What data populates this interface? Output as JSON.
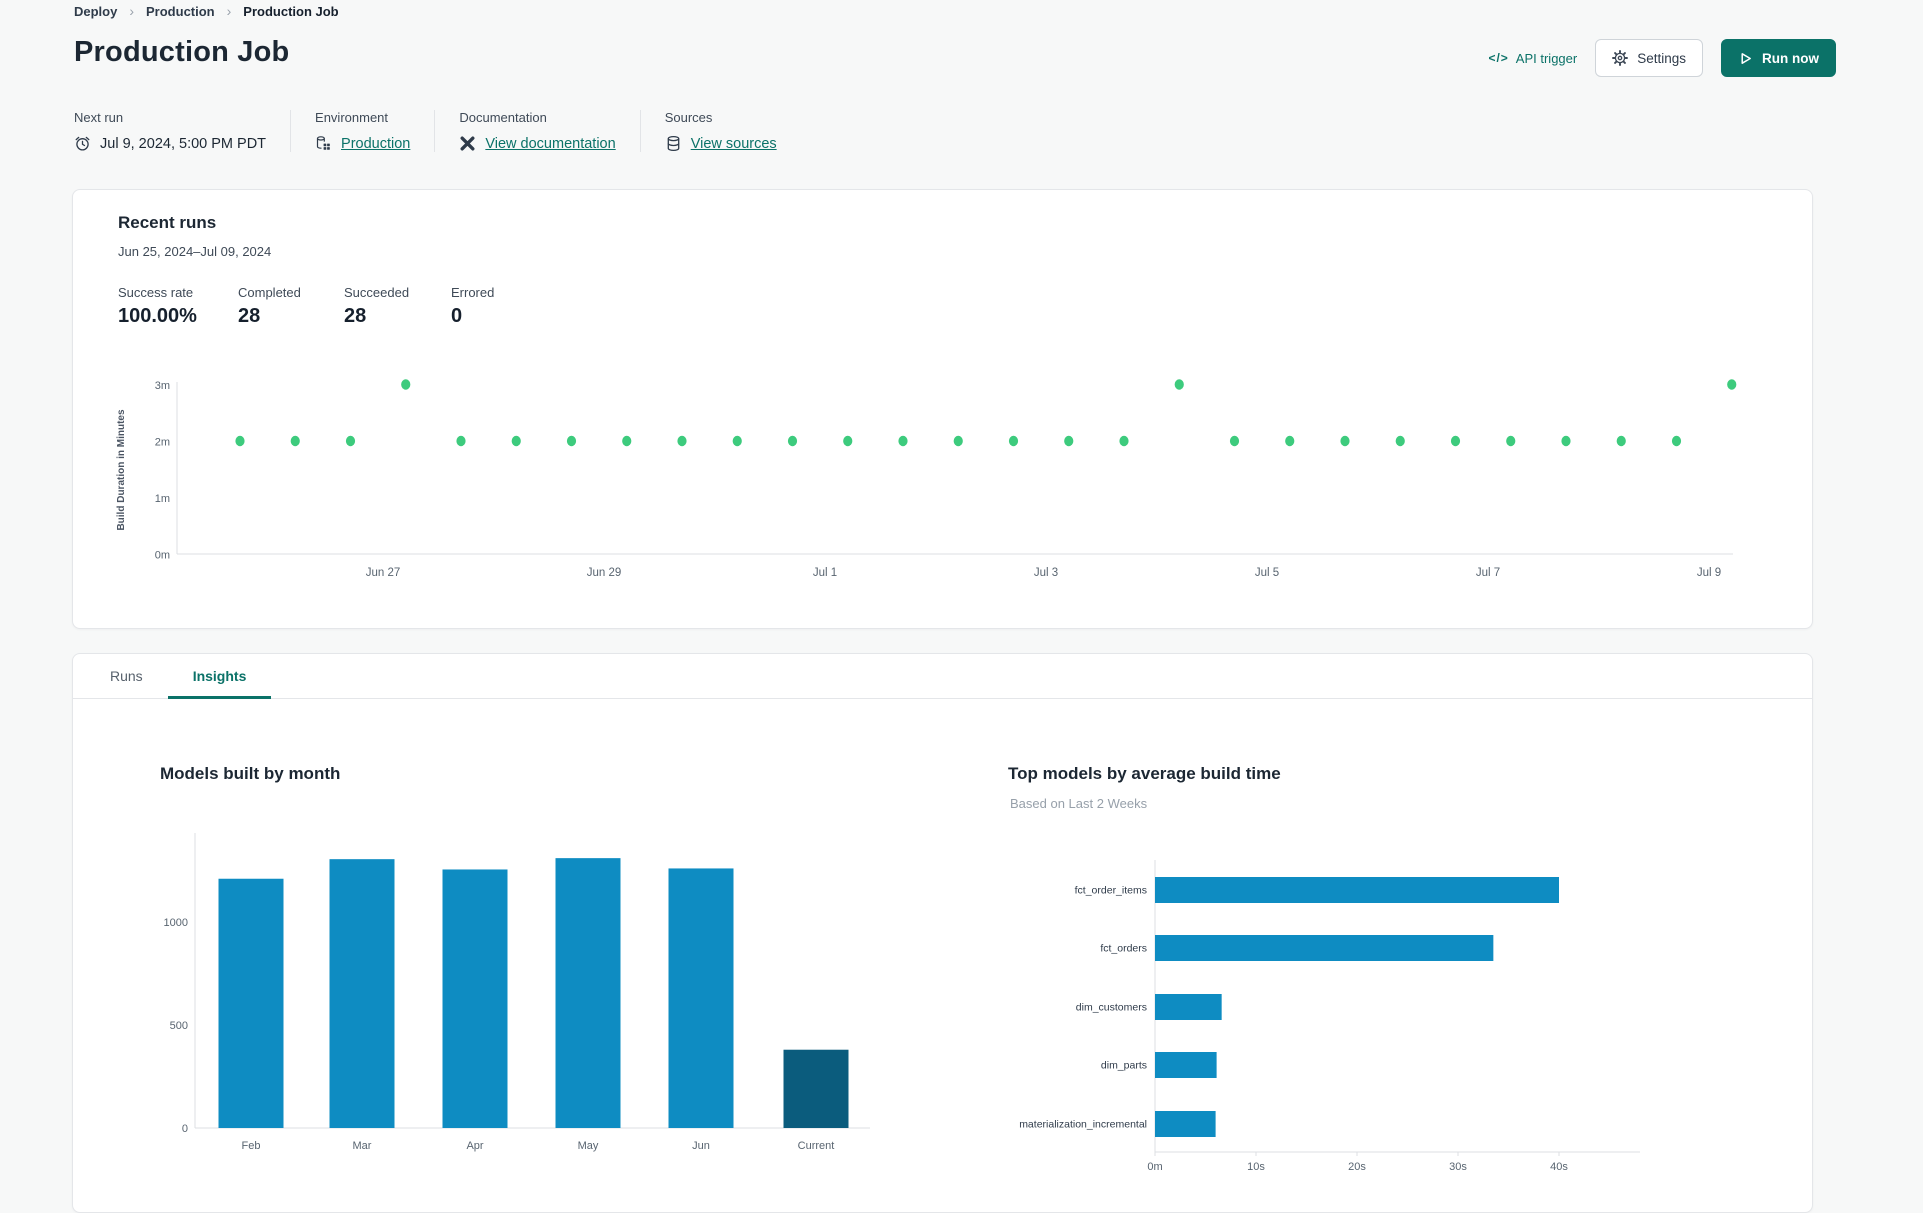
{
  "colors": {
    "teal": "#0B7268",
    "green_dot": "#3DCB7D",
    "bar_blue": "#0E8CC2",
    "bar_dark_blue": "#0B5C7D",
    "axis_line": "#DCDFE3",
    "tick_text": "#586470"
  },
  "breadcrumb": {
    "items": [
      {
        "label": "Deploy"
      },
      {
        "label": "Production"
      },
      {
        "label": "Production Job"
      }
    ]
  },
  "header": {
    "title": "Production Job",
    "api_trigger_icon": "</>",
    "api_trigger_label": "API trigger",
    "settings_label": "Settings",
    "run_now_label": "Run now"
  },
  "meta": {
    "next_run": {
      "label": "Next run",
      "value": "Jul 9, 2024, 5:00 PM PDT"
    },
    "environment": {
      "label": "Environment",
      "value": "Production"
    },
    "documentation": {
      "label": "Documentation",
      "value": "View documentation"
    },
    "sources": {
      "label": "Sources",
      "value": "View sources"
    }
  },
  "recent_runs": {
    "title": "Recent runs",
    "date_range": "Jun 25, 2024–Jul 09, 2024",
    "stats": [
      {
        "label": "Success rate",
        "value": "100.00%"
      },
      {
        "label": "Completed",
        "value": "28"
      },
      {
        "label": "Succeeded",
        "value": "28"
      },
      {
        "label": "Errored",
        "value": "0"
      }
    ]
  },
  "tabs": [
    {
      "label": "Runs",
      "active": false
    },
    {
      "label": "Insights",
      "active": true
    }
  ],
  "chart_data": [
    {
      "id": "build-duration-scatter",
      "type": "scatter",
      "title": "Recent runs",
      "ylabel": "Build Duration in Minutes",
      "y_ticks": [
        "0m",
        "1m",
        "2m",
        "3m"
      ],
      "x_ticks": [
        "Jun 27",
        "Jun 29",
        "Jul 1",
        "Jul 3",
        "Jul 5",
        "Jul 7",
        "Jul 9"
      ],
      "ylim": [
        0,
        3.3
      ],
      "grid": false,
      "point_color": "#3DCB7D",
      "durations_minutes": [
        2,
        2,
        2,
        3,
        2,
        2,
        2,
        2,
        2,
        2,
        2,
        2,
        2,
        2,
        2,
        2,
        2,
        3,
        2,
        2,
        2,
        2,
        2,
        2,
        2,
        2,
        2,
        3
      ]
    },
    {
      "id": "models-built-by-month",
      "type": "bar",
      "title": "Models built by month",
      "categories": [
        "Feb",
        "Mar",
        "Apr",
        "May",
        "Jun",
        "Current"
      ],
      "values": [
        1210,
        1305,
        1255,
        1310,
        1260,
        380
      ],
      "y_ticks": [
        0,
        500,
        1000
      ],
      "ylim": [
        0,
        1430
      ],
      "xlabel": "",
      "ylabel": "",
      "grid": false,
      "bar_color": "#0E8CC2",
      "current_bar_color": "#0B5C7D"
    },
    {
      "id": "top-models-by-average-build-time",
      "type": "bar_horizontal",
      "title": "Top models by average build time",
      "subtitle": "Based on Last 2 Weeks",
      "categories": [
        "fct_order_items",
        "fct_orders",
        "dim_customers",
        "dim_parts",
        "materialization_incremental"
      ],
      "values_seconds": [
        40.0,
        33.5,
        6.6,
        6.1,
        6.0
      ],
      "x_ticks": [
        "0m",
        "10s",
        "20s",
        "30s",
        "40s"
      ],
      "xlim": [
        0,
        48
      ],
      "grid": false,
      "bar_color": "#0E8CC2"
    }
  ]
}
